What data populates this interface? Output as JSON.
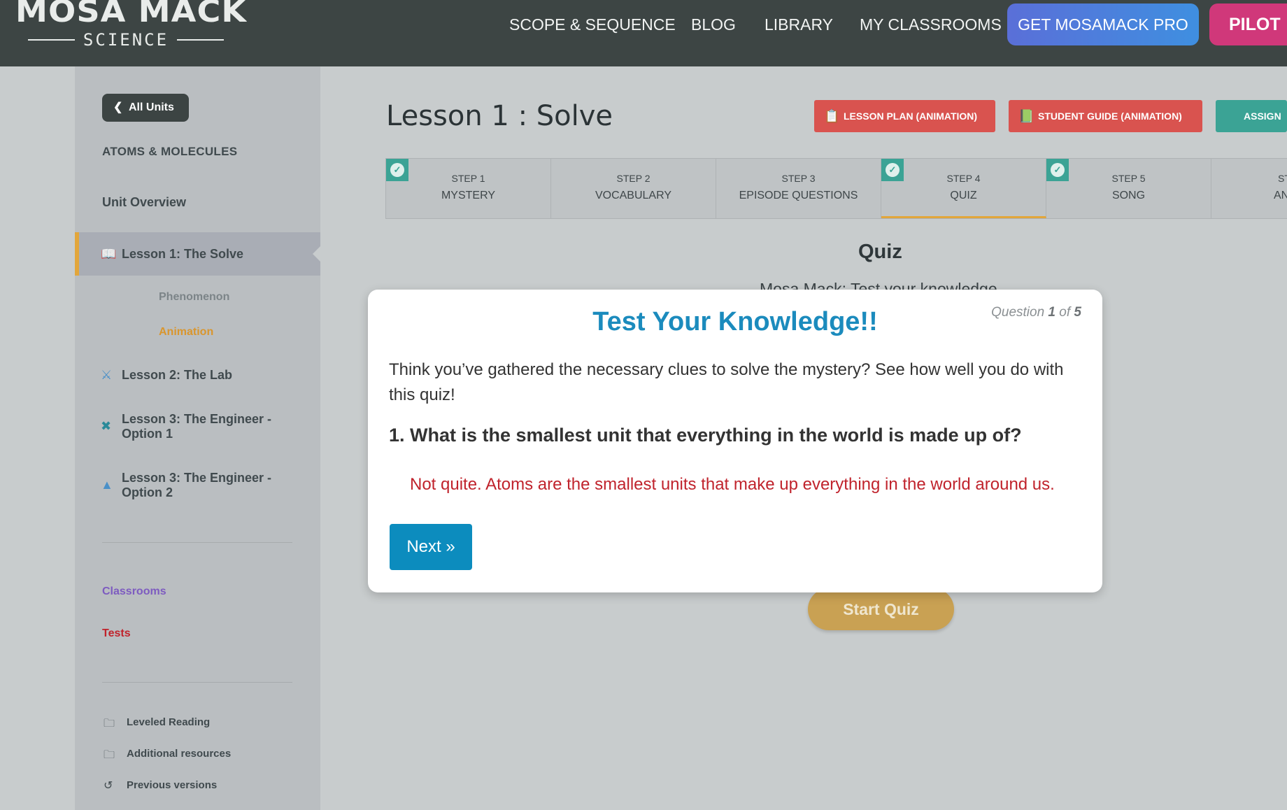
{
  "nav": {
    "logo_main": "MOSA MACK",
    "logo_sub": "SCIENCE",
    "links": [
      "SCOPE & SEQUENCE",
      "BLOG",
      "LIBRARY",
      "MY CLASSROOMS"
    ],
    "pro_label": "GET MOSAMACK PRO",
    "pilot_label": "PILOT"
  },
  "sidebar": {
    "all_units": "All Units",
    "unit_title": "ATOMS & MOLECULES",
    "unit_overview": "Unit Overview",
    "lessons": [
      {
        "label": "Lesson 1: The Solve",
        "icon": "book-icon"
      },
      {
        "label": "Lesson 2: The Lab",
        "icon": "flask-icon"
      },
      {
        "label_line1": "Lesson 3: The Engineer -",
        "label_line2": "Option 1",
        "icon": "tools-icon"
      },
      {
        "label_line1": "Lesson 3: The Engineer -",
        "label_line2": "Option 2",
        "icon": "flask-icon"
      }
    ],
    "sub_items": [
      "Phenomenon",
      "Animation"
    ],
    "classrooms": "Classrooms",
    "tests": "Tests",
    "resources": [
      "Leveled Reading",
      "Additional resources",
      "Previous versions"
    ]
  },
  "main": {
    "lesson_title": "Lesson 1 : Solve",
    "buttons": {
      "lesson_plan": "LESSON PLAN (ANIMATION)",
      "student_guide": "STUDENT GUIDE (ANIMATION)",
      "assign": "ASSIGN"
    },
    "steps": [
      {
        "num": "STEP 1",
        "name": "MYSTERY",
        "done": true
      },
      {
        "num": "STEP 2",
        "name": "VOCABULARY",
        "done": false
      },
      {
        "num": "STEP 3",
        "name": "EPISODE QUESTIONS",
        "done": false
      },
      {
        "num": "STEP 4",
        "name": "QUIZ",
        "done": true
      },
      {
        "num": "STEP 5",
        "name": "SONG",
        "done": true
      },
      {
        "num": "ST",
        "name": "ANI",
        "done": false
      }
    ],
    "quiz_heading": "Quiz",
    "quiz_sub": "Mosa Mack: Test your knowledge",
    "start_quiz": "Start Quiz"
  },
  "modal": {
    "title": "Test Your Knowledge!!",
    "counter_prefix": "Question",
    "counter_current": "1",
    "counter_of": "of",
    "counter_total": "5",
    "intro": "Think you’ve gathered the necessary clues to solve the mystery? See how well you do with this quiz!",
    "question": "1. What is the smallest unit that everything in the world is made up of?",
    "feedback": "Not quite. Atoms are the smallest units that make up everything in the world around us.",
    "next_label": "Next »"
  },
  "colors": {
    "nav_bg": "#3d4544",
    "accent_orange": "#e2a63b",
    "teal": "#3ba395",
    "red_button": "#d9534f",
    "modal_title": "#1b8bbd",
    "feedback_red": "#c0232c",
    "next_button": "#0c8cbe"
  }
}
